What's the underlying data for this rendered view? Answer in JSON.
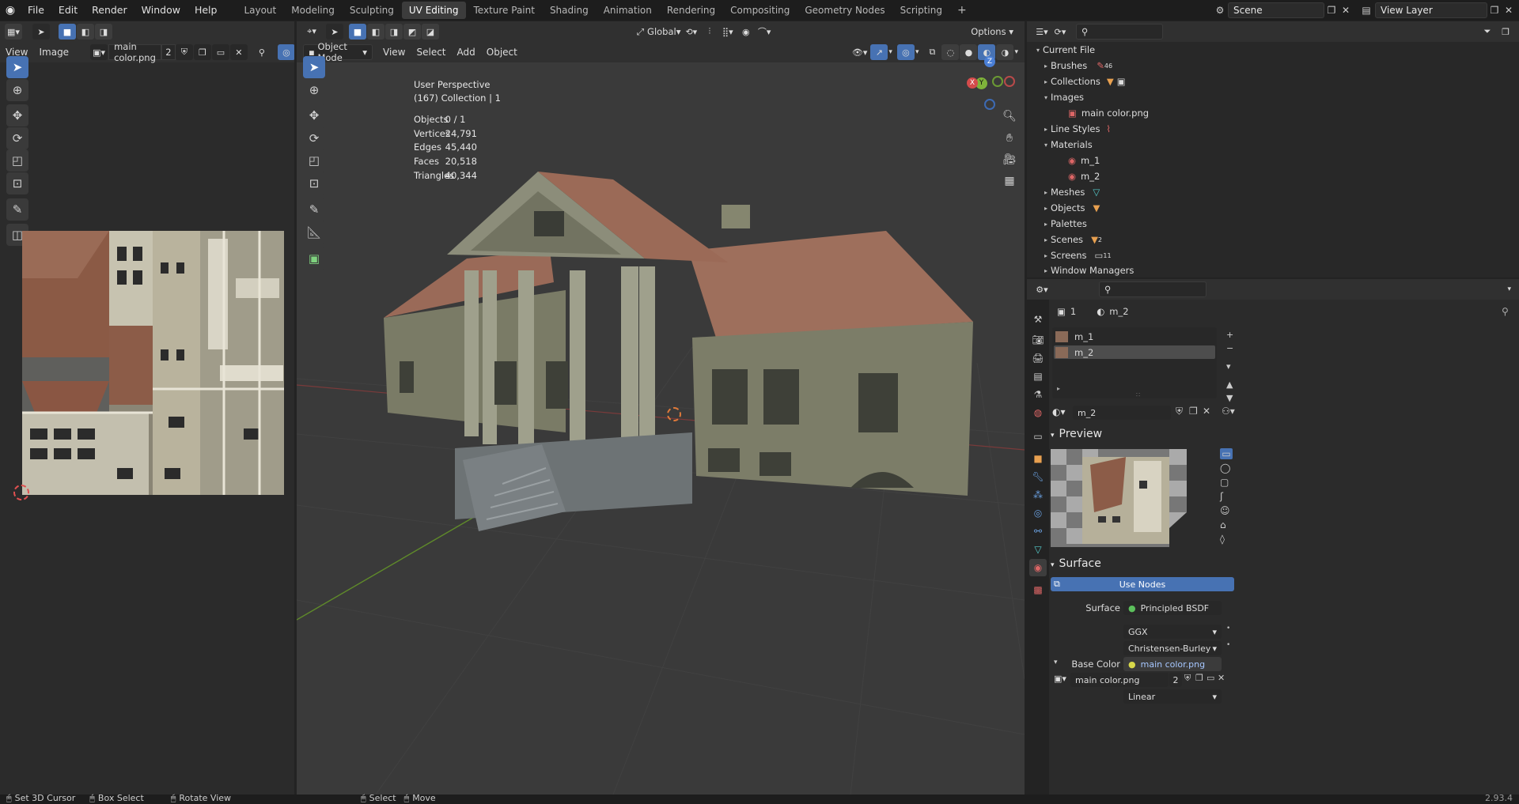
{
  "topbar": {
    "menus": [
      "File",
      "Edit",
      "Render",
      "Window",
      "Help"
    ],
    "workspaces": [
      "Layout",
      "Modeling",
      "Sculpting",
      "UV Editing",
      "Texture Paint",
      "Shading",
      "Animation",
      "Rendering",
      "Compositing",
      "Geometry Nodes",
      "Scripting"
    ],
    "active_workspace": "UV Editing",
    "scene": "Scene",
    "view_layer": "View Layer"
  },
  "image_editor": {
    "menus": [
      "View",
      "Image"
    ],
    "image_name": "main color.png",
    "users": "2"
  },
  "viewport": {
    "mode": "Object Mode",
    "menus": [
      "View",
      "Select",
      "Add",
      "Object"
    ],
    "orientation": "Global",
    "options": "Options",
    "perspective": "User Perspective",
    "collection": "(167) Collection | 1",
    "stats": [
      {
        "label": "Objects",
        "value": "0 / 1"
      },
      {
        "label": "Vertices",
        "value": "24,791"
      },
      {
        "label": "Edges",
        "value": "45,440"
      },
      {
        "label": "Faces",
        "value": "20,518"
      },
      {
        "label": "Triangles",
        "value": "40,344"
      }
    ],
    "gizmo": {
      "z": "Z",
      "y": "Y",
      "x": "X"
    }
  },
  "outliner": {
    "root": "Current File",
    "items": [
      {
        "label": "Brushes",
        "open": false,
        "badge": "46"
      },
      {
        "label": "Collections",
        "open": false
      },
      {
        "label": "Images",
        "open": true
      },
      {
        "label": "main color.png",
        "child": true
      },
      {
        "label": "Line Styles",
        "open": false
      },
      {
        "label": "Materials",
        "open": true
      },
      {
        "label": "m_1",
        "child": true
      },
      {
        "label": "m_2",
        "child": true
      },
      {
        "label": "Meshes",
        "open": false
      },
      {
        "label": "Objects",
        "open": false
      },
      {
        "label": "Palettes",
        "open": false
      },
      {
        "label": "Scenes",
        "open": false,
        "badge": "2"
      },
      {
        "label": "Screens",
        "open": false,
        "badge": "11"
      },
      {
        "label": "Window Managers",
        "open": false
      }
    ]
  },
  "properties": {
    "object_count": "1",
    "material_name": "m_2",
    "slots": [
      "m_1",
      "m_2"
    ],
    "active_slot": "m_2",
    "material_field": "m_2",
    "preview_label": "Preview",
    "surface_label": "Surface",
    "use_nodes": "Use Nodes",
    "surface_field_label": "Surface",
    "surface_value": "Principled BSDF",
    "distribution": "GGX",
    "subsurface": "Christensen-Burley",
    "base_color_label": "Base Color",
    "base_color_value": "main color.png",
    "image_field": "main color.png",
    "image_users": "2",
    "interpolation": "Linear"
  },
  "statusbar": {
    "hints": [
      "Set 3D Cursor",
      "Box Select",
      "Rotate View",
      "Select",
      "Move"
    ],
    "version": "2.93.4"
  },
  "colors": {
    "accent": "#4772b3",
    "background": "#303030",
    "viewport_bg": "#3b3b3b"
  }
}
